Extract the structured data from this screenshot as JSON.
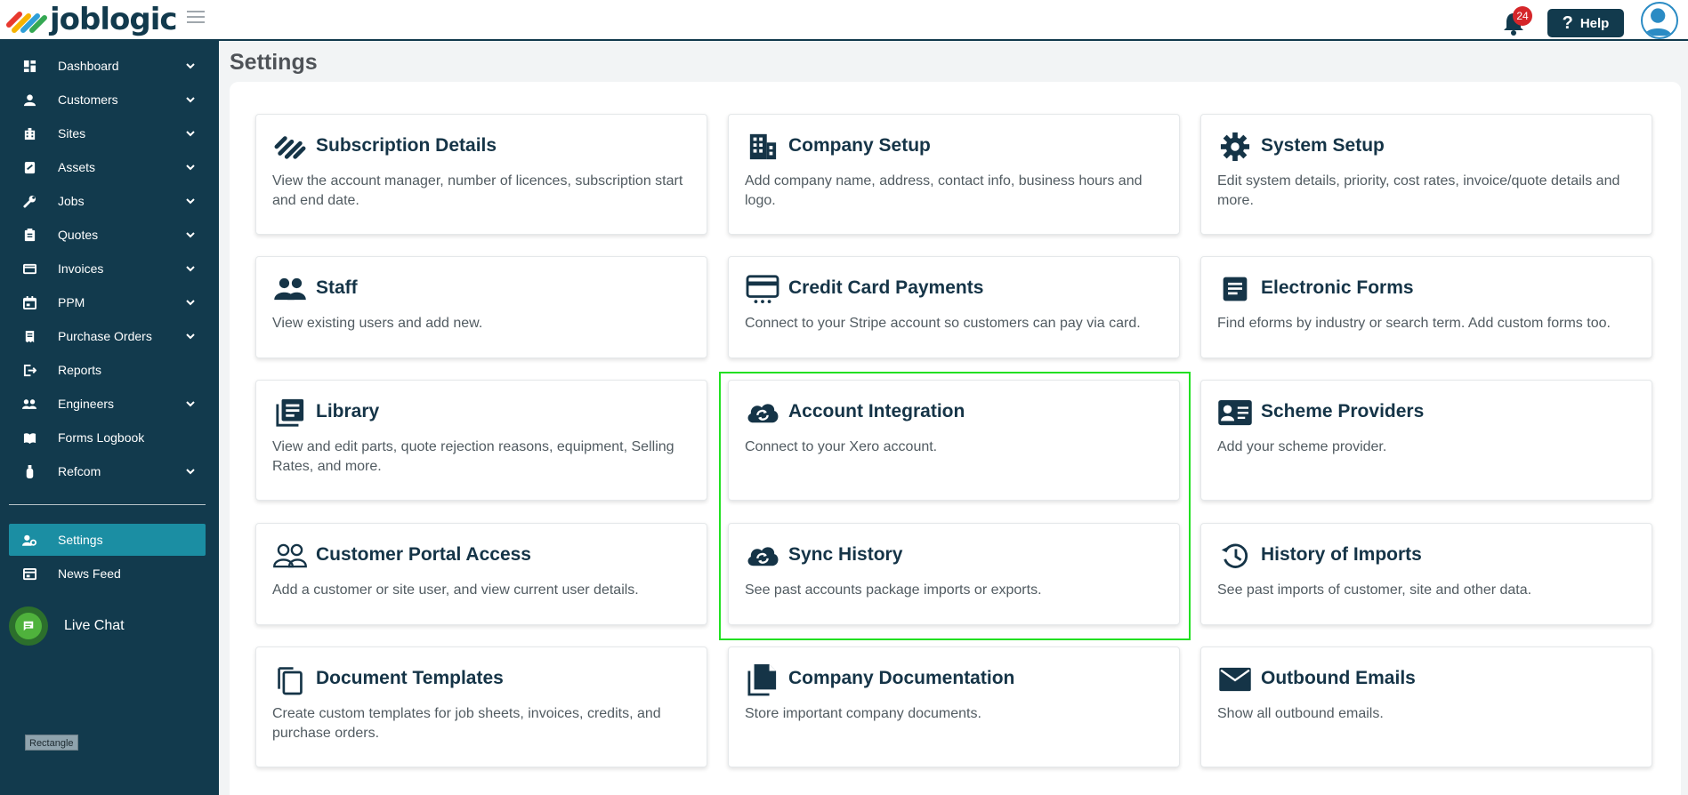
{
  "header": {
    "logo_text": "joblogic",
    "notification_count": "24",
    "help_label": "Help"
  },
  "sidebar": {
    "items": [
      {
        "label": "Dashboard",
        "icon": "dashboard-icon",
        "has_chevron": true
      },
      {
        "label": "Customers",
        "icon": "person-icon",
        "has_chevron": true
      },
      {
        "label": "Sites",
        "icon": "building-icon",
        "has_chevron": true
      },
      {
        "label": "Assets",
        "icon": "asset-icon",
        "has_chevron": true
      },
      {
        "label": "Jobs",
        "icon": "wrench-icon",
        "has_chevron": true
      },
      {
        "label": "Quotes",
        "icon": "clipboard-icon",
        "has_chevron": true
      },
      {
        "label": "Invoices",
        "icon": "card-icon",
        "has_chevron": true
      },
      {
        "label": "PPM",
        "icon": "calendar-icon",
        "has_chevron": true
      },
      {
        "label": "Purchase Orders",
        "icon": "receipt-icon",
        "has_chevron": true
      },
      {
        "label": "Reports",
        "icon": "exit-icon",
        "has_chevron": false
      },
      {
        "label": "Engineers",
        "icon": "people-icon",
        "has_chevron": true
      },
      {
        "label": "Forms Logbook",
        "icon": "book-icon",
        "has_chevron": false
      },
      {
        "label": "Refcom",
        "icon": "cylinder-icon",
        "has_chevron": true
      }
    ],
    "bottom_items": [
      {
        "label": "Settings",
        "icon": "user-settings-icon",
        "active": true
      },
      {
        "label": "News Feed",
        "icon": "news-icon",
        "active": false
      }
    ],
    "live_chat_label": "Live Chat",
    "rect_tag_label": "Rectangle"
  },
  "main": {
    "page_title": "Settings",
    "cards": [
      {
        "title": "Subscription Details",
        "desc": "View the account manager, number of licences, subscription start and end date.",
        "icon": "joblogic-stripes-icon"
      },
      {
        "title": "Company Setup",
        "desc": "Add company name, address, contact info, business hours and logo.",
        "icon": "building-icon"
      },
      {
        "title": "System Setup",
        "desc": "Edit system details, priority, cost rates, invoice/quote details and more.",
        "icon": "gear-icon"
      },
      {
        "title": "Staff",
        "desc": "View existing users and add new.",
        "icon": "people-icon"
      },
      {
        "title": "Credit Card Payments",
        "desc": "Connect to your Stripe account so customers can pay via card.",
        "icon": "credit-card-icon"
      },
      {
        "title": "Electronic Forms",
        "desc": "Find eforms by industry or search term. Add custom forms too.",
        "icon": "form-icon"
      },
      {
        "title": "Library",
        "desc": "View and edit parts, quote rejection reasons, equipment, Selling Rates, and more.",
        "icon": "library-icon"
      },
      {
        "title": "Account Integration",
        "desc": "Connect to your Xero account.",
        "icon": "cloud-sync-icon"
      },
      {
        "title": "Scheme Providers",
        "desc": "Add your scheme provider.",
        "icon": "id-card-icon"
      },
      {
        "title": "Customer Portal Access",
        "desc": "Add a customer or site user, and view current user details.",
        "icon": "people-outline-icon"
      },
      {
        "title": "Sync History",
        "desc": "See past accounts package imports or exports.",
        "icon": "cloud-sync-icon"
      },
      {
        "title": "History of Imports",
        "desc": "See past imports of customer, site and other data.",
        "icon": "history-icon"
      },
      {
        "title": "Document Templates",
        "desc": "Create custom templates for job sheets, invoices, credits, and purchase orders.",
        "icon": "copy-icon"
      },
      {
        "title": "Company Documentation",
        "desc": "Store important company documents.",
        "icon": "document-icon"
      },
      {
        "title": "Outbound Emails",
        "desc": "Show all outbound emails.",
        "icon": "envelope-icon"
      }
    ]
  },
  "colors": {
    "sidebar_bg": "#123a4d",
    "active_item": "#1b8ea3",
    "badge": "#d5262a",
    "highlight": "#22e022",
    "card_title": "#153447"
  }
}
